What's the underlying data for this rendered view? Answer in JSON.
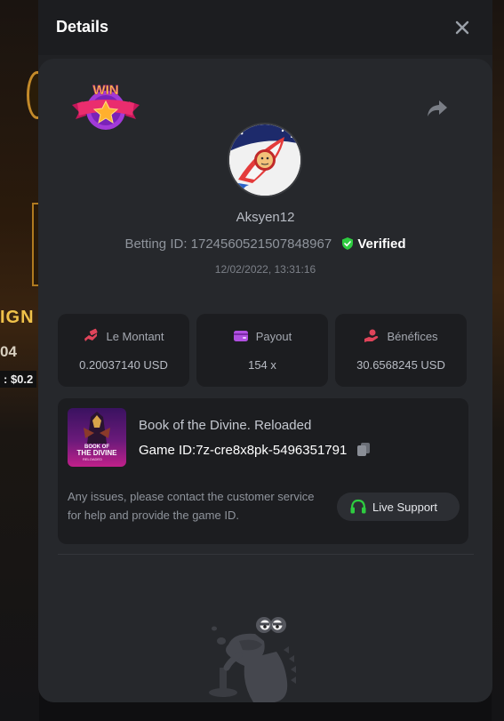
{
  "background": {
    "text_ign": "IGN",
    "text_04": "04",
    "text_cost": ": $0.2"
  },
  "modal": {
    "title": "Details",
    "badge_text": "WIN",
    "username": "Aksyen12",
    "betting_id": "Betting ID: 1724560521507848967",
    "verified_label": "Verified",
    "timestamp": "12/02/2022, 13:31:16",
    "stats": [
      {
        "label": "Le Montant",
        "value": "0.20037140 USD",
        "icon": "money-hand-icon"
      },
      {
        "label": "Payout",
        "value": "154 x",
        "icon": "wallet-icon"
      },
      {
        "label": "Bénéfices",
        "value": "30.6568245 USD",
        "icon": "profit-hand-icon"
      }
    ],
    "game": {
      "title": "Book of the Divine. Reloaded",
      "id_label": "Game ID:",
      "id_value": "7z-cre8x8pk-5496351791",
      "thumb_line1": "BOOK OF",
      "thumb_line2": "THE DIVINE",
      "thumb_line3": "RELOADED"
    },
    "support": {
      "text": "Any issues, please contact the customer service for help and provide the game ID.",
      "button_label": "Live Support"
    }
  },
  "colors": {
    "panel": "#202124",
    "card": "#26282c",
    "box": "#1c1d20",
    "verified": "#2ecc40",
    "stat_icon": "#e0445a",
    "payout_icon": "#b04fe0"
  }
}
